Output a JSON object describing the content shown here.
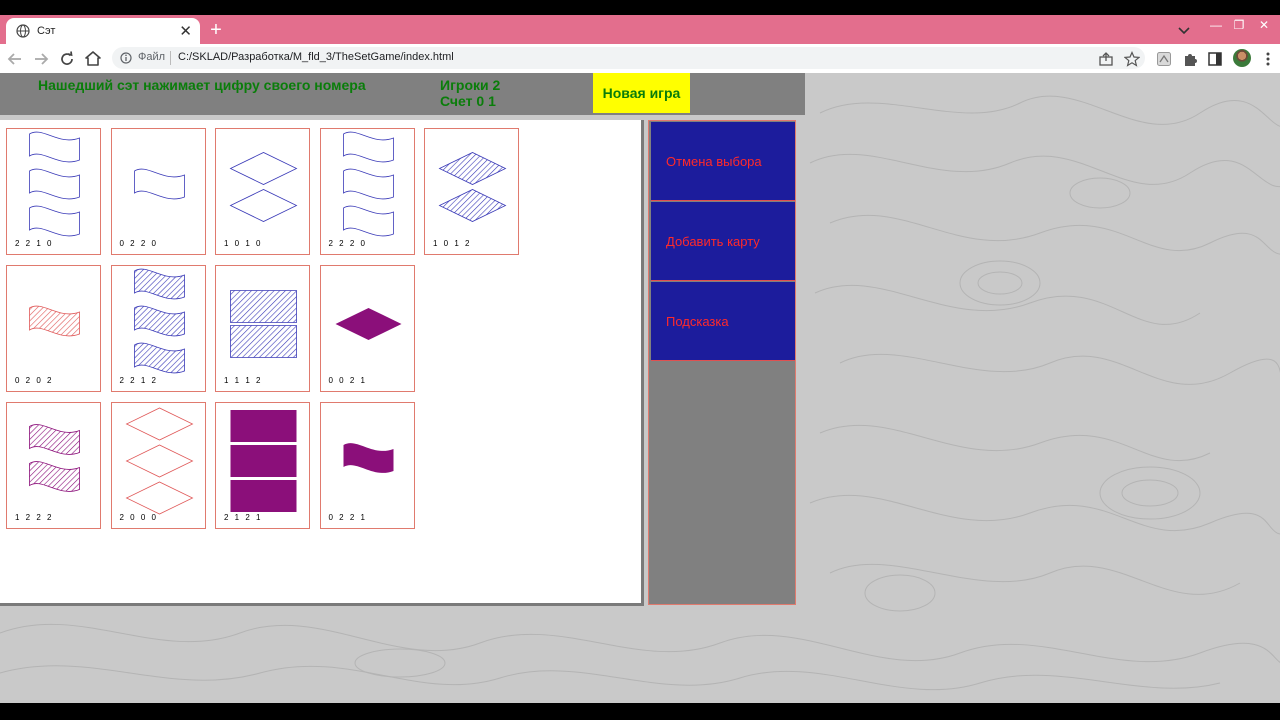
{
  "browser": {
    "tab_title": "Сэт",
    "address_prefix": "Файл",
    "url": "C:/SKLAD/Разработка/M_fld_3/TheSetGame/index.html"
  },
  "game": {
    "hint": "Нашедший сэт нажимает цифру своего номера",
    "players": "Игроки 2",
    "score": "Счет 0 1",
    "new_game": "Новая игра"
  },
  "panel": {
    "cancel_selection": "Отмена выбора",
    "add_card": "Добавить карту",
    "hint_button": "Подсказка"
  },
  "colors": {
    "blue": "#3b3bb8",
    "red": "#e05a5a",
    "purple": "#8b0f7a",
    "accent_green": "#0a7d0a",
    "panel_button": "#1c1c9c"
  },
  "cards": [
    {
      "code": "2 2 1 0",
      "count": 3,
      "shape": "wave",
      "color": "blue",
      "fill": "empty"
    },
    {
      "code": "0 2 2 0",
      "count": 1,
      "shape": "wave",
      "color": "blue",
      "fill": "empty"
    },
    {
      "code": "1 0 1 0",
      "count": 2,
      "shape": "diamond",
      "color": "blue",
      "fill": "empty"
    },
    {
      "code": "2 2 2 0",
      "count": 3,
      "shape": "wave",
      "color": "blue",
      "fill": "empty"
    },
    {
      "code": "1 0 1 2",
      "count": 2,
      "shape": "diamond",
      "color": "blue",
      "fill": "hatched"
    },
    {
      "code": "0 2 0 2",
      "count": 1,
      "shape": "wave",
      "color": "red",
      "fill": "hatched"
    },
    {
      "code": "2 2 1 2",
      "count": 3,
      "shape": "wave",
      "color": "blue",
      "fill": "hatched"
    },
    {
      "code": "1 1 1 2",
      "count": 2,
      "shape": "rect",
      "color": "blue",
      "fill": "hatched"
    },
    {
      "code": "0 0 2 1",
      "count": 1,
      "shape": "diamond",
      "color": "purple",
      "fill": "solid"
    },
    {
      "code": "1 2 2 2",
      "count": 2,
      "shape": "wave",
      "color": "purple",
      "fill": "hatched"
    },
    {
      "code": "2 0 0 0",
      "count": 3,
      "shape": "diamond",
      "color": "red",
      "fill": "empty"
    },
    {
      "code": "2 1 2 1",
      "count": 3,
      "shape": "rect",
      "color": "purple",
      "fill": "solid"
    },
    {
      "code": "0 2 2 1",
      "count": 1,
      "shape": "wave",
      "color": "purple",
      "fill": "solid"
    }
  ]
}
